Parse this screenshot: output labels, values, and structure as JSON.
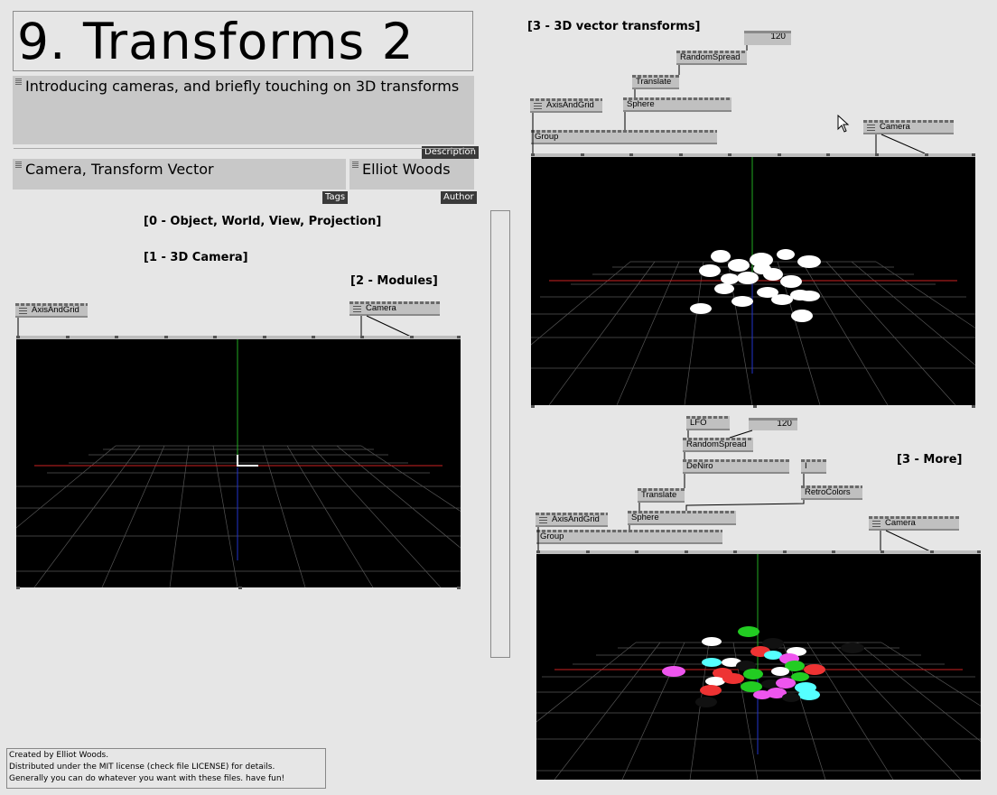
{
  "title": "9. Transforms 2",
  "description": {
    "text": "Introducing cameras, and briefly touching on 3D transforms",
    "tag": "Description"
  },
  "tags": {
    "text": "Camera, Transform Vector",
    "tag": "Tags"
  },
  "author": {
    "text": "Elliot Woods",
    "tag": "Author"
  },
  "sections": {
    "s0": "[0 - Object, World, View, Projection]",
    "s1": "[1 - 3D Camera]",
    "s2": "[2 - Modules]",
    "s3": "[3 - 3D vector transforms]",
    "s3b": "[3 - More]"
  },
  "nodes": {
    "axis1": "AxisAndGrid",
    "camera1": "Camera",
    "axis2": "AxisAndGrid",
    "sphere2": "Sphere",
    "translate2": "Translate",
    "randomspread2": "RandomSpread",
    "group2": "Group",
    "camera2": "Camera",
    "num2": "120",
    "lfo3": "LFO",
    "num3": "120",
    "randomspread3": "RandomSpread",
    "deniro3": "DeNiro",
    "i3": "I",
    "retrocolors3": "RetroColors",
    "translate3": "Translate",
    "axis3": "AxisAndGrid",
    "sphere3": "Sphere",
    "group3": "Group",
    "camera3": "Camera"
  },
  "footer": {
    "line1": "Created by Elliot Woods.",
    "line2": "Distributed under the MIT license (check file LICENSE) for details.",
    "line3": "Generally you can do whatever you want with these files. have fun!"
  },
  "colors": {
    "bg": "#e6e6e6",
    "node": "#c0c0c0",
    "renderer": "#000000",
    "grid": "#555555",
    "xaxis": "#cc2222",
    "yaxis": "#22aa22",
    "zaxis": "#2233cc"
  }
}
